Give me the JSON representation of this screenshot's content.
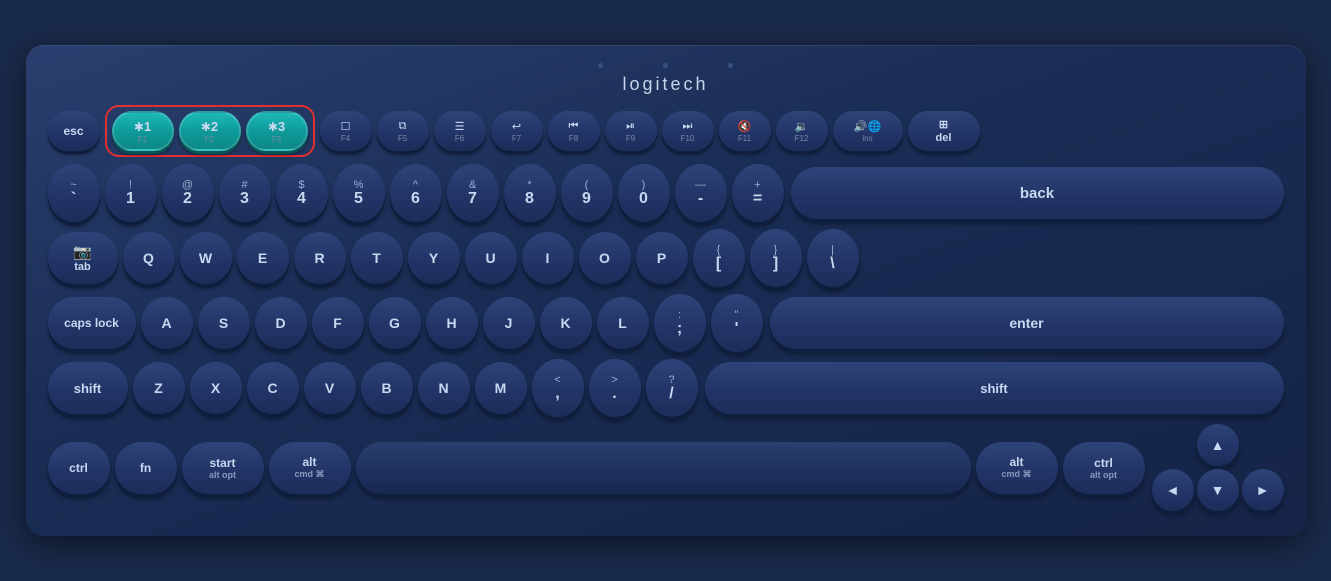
{
  "logo": "logitech",
  "highlight_color": "#e03030",
  "teal_color": "#0f9a9a",
  "keyboard": {
    "fn_row": [
      {
        "label": "esc",
        "type": "esc"
      },
      {
        "bt": true,
        "label": "✱",
        "num": "1",
        "fn": "F1"
      },
      {
        "bt": true,
        "label": "✱",
        "num": "2",
        "fn": "F2"
      },
      {
        "bt": true,
        "label": "✱",
        "num": "3",
        "fn": "F3"
      },
      {
        "icon": "☐",
        "fn": "F4"
      },
      {
        "icon": "⧉",
        "fn": "F5"
      },
      {
        "icon": "≡",
        "fn": "F6"
      },
      {
        "icon": "↩",
        "fn": "F7"
      },
      {
        "icon": "◀◀",
        "fn": "F8"
      },
      {
        "icon": "▶⏸",
        "fn": "F9"
      },
      {
        "icon": "▶▶",
        "fn": "F10"
      },
      {
        "icon": "🔇",
        "fn": "F11"
      },
      {
        "icon": "🔉",
        "fn": "F12"
      },
      {
        "icon": "🔊🌐",
        "fn": "ins"
      },
      {
        "label": "⊞ del",
        "type": "del"
      }
    ],
    "num_row": [
      "~`",
      "!1",
      "@2",
      "#3",
      "$4",
      "%5",
      "^6",
      "&7",
      "*8",
      "(9",
      ")0",
      "—-",
      "+=",
      "back"
    ],
    "qwerty_row": [
      "tab",
      "Q",
      "W",
      "E",
      "R",
      "T",
      "Y",
      "U",
      "I",
      "O",
      "P",
      "{[",
      "}]",
      "|\\"
    ],
    "home_row": [
      "caps lock",
      "A",
      "S",
      "D",
      "F",
      "G",
      "H",
      "J",
      "K",
      "L",
      ":;",
      "\"'",
      "enter"
    ],
    "shift_row": [
      "shift",
      "Z",
      "X",
      "C",
      "V",
      "B",
      "N",
      "M",
      "<,",
      ">.",
      "?/",
      "shift"
    ],
    "bottom_row": [
      "ctrl",
      "fn",
      "start/alt opt",
      "alt/cmd ⌘",
      "space",
      "alt/cmd ⌘",
      "ctrl/alt opt",
      "◄",
      "▲▼",
      "►"
    ]
  }
}
